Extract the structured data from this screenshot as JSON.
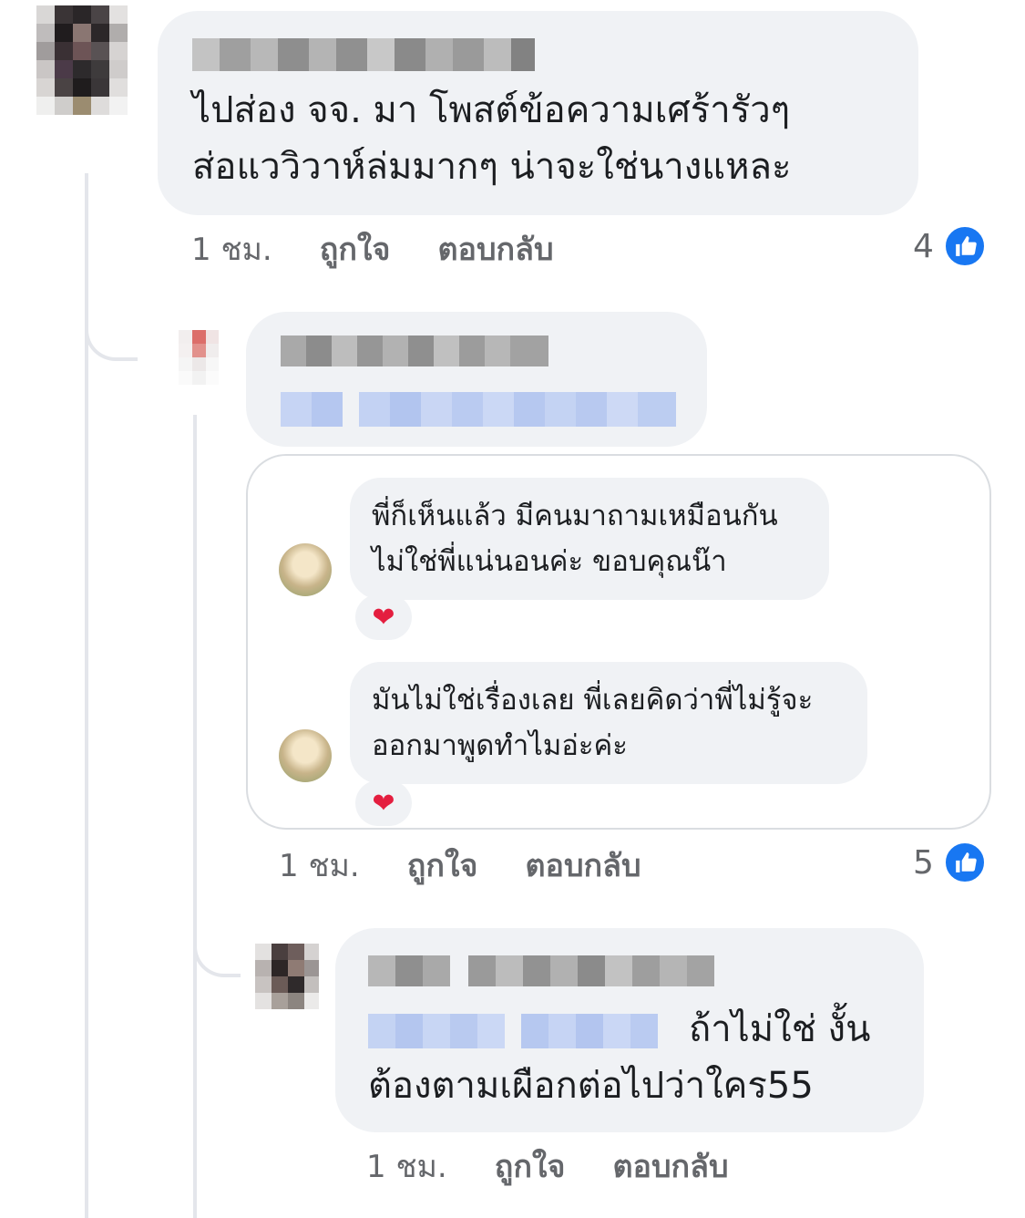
{
  "colors": {
    "bubble_bg": "#f0f2f5",
    "meta_text": "#65676b",
    "like_blue": "#1877f2",
    "heart_red": "#e41e3f",
    "thread_line": "#e4e6eb"
  },
  "comments": [
    {
      "text": "ไปส่อง จจ. มา โพสต์ข้อความเศร้ารัวๆ\nส่อแววิวาห์ล่มมากๆ น่าจะใช่นางแหละ",
      "time": "1 ชม.",
      "like_label": "ถูกใจ",
      "reply_label": "ตอบกลับ",
      "like_count": "4",
      "like_icon": "thumbs-up-icon"
    },
    {
      "time": "1 ชม.",
      "like_label": "ถูกใจ",
      "reply_label": "ตอบกลับ",
      "like_count": "5",
      "like_icon": "thumbs-up-icon",
      "embedded_screenshot": [
        {
          "text": "พี่ก็เห็นแล้ว มีคนมาถามเหมือนกัน\nไม่ใช่พี่แน่นอนค่ะ ขอบคุณน๊า",
          "reaction": "❤"
        },
        {
          "text": "มันไม่ใช่เรื่องเลย พี่เลยคิดว่าพี่ไม่รู้จะ\nออกมาพูดทำไมอ่ะค่ะ",
          "reaction": "❤"
        }
      ]
    },
    {
      "text_line1": "ถ้าไม่ใช่ งั้น",
      "text_line2": "ต้องตามเผือกต่อไปว่าใคร55",
      "time": "1 ชม.",
      "like_label": "ถูกใจ",
      "reply_label": "ตอบกลับ"
    }
  ]
}
